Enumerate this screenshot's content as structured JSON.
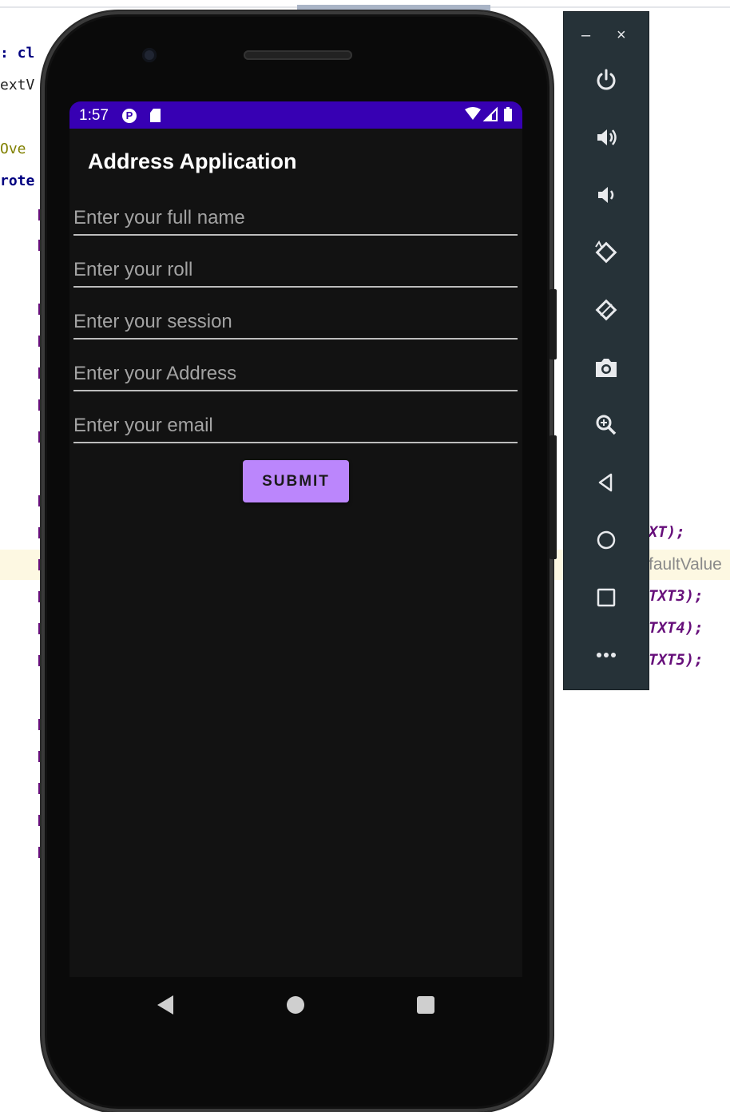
{
  "background_code": {
    "left_fragments": [
      ": cl",
      "extV",
      "Ove",
      "rote"
    ],
    "right_fragments": [
      "XT);",
      "faultValue",
      "TXT3);",
      "TXT4);",
      "TXT5);"
    ],
    "mid_fragments": [
      "1",
      "e)",
      "y",
      "y",
      "y"
    ]
  },
  "status_bar": {
    "time": "1:57",
    "status_p_icon": "P",
    "right_icons": "wifi-icon, signal-icon, battery-icon",
    "color": "#3700b3"
  },
  "app": {
    "title": "Address Application",
    "fields": [
      {
        "placeholder": "Enter your full name",
        "value": ""
      },
      {
        "placeholder": "Enter your roll",
        "value": ""
      },
      {
        "placeholder": "Enter your session",
        "value": ""
      },
      {
        "placeholder": "Enter your Address",
        "value": ""
      },
      {
        "placeholder": "Enter your email",
        "value": ""
      }
    ],
    "submit_label": "SUBMIT",
    "accent": "#bb86fc",
    "background": "#121212"
  },
  "nav_bar": {
    "icons": [
      "back-icon",
      "home-icon",
      "recents-icon"
    ]
  },
  "emulator_panel": {
    "minimize": "–",
    "close": "×",
    "buttons": [
      "power-icon",
      "volume-up-icon",
      "volume-down-icon",
      "rotate-left-icon",
      "rotate-right-icon",
      "camera-icon",
      "zoom-icon",
      "back-icon",
      "home-icon",
      "overview-icon",
      "more-icon"
    ],
    "color": "#263238"
  }
}
